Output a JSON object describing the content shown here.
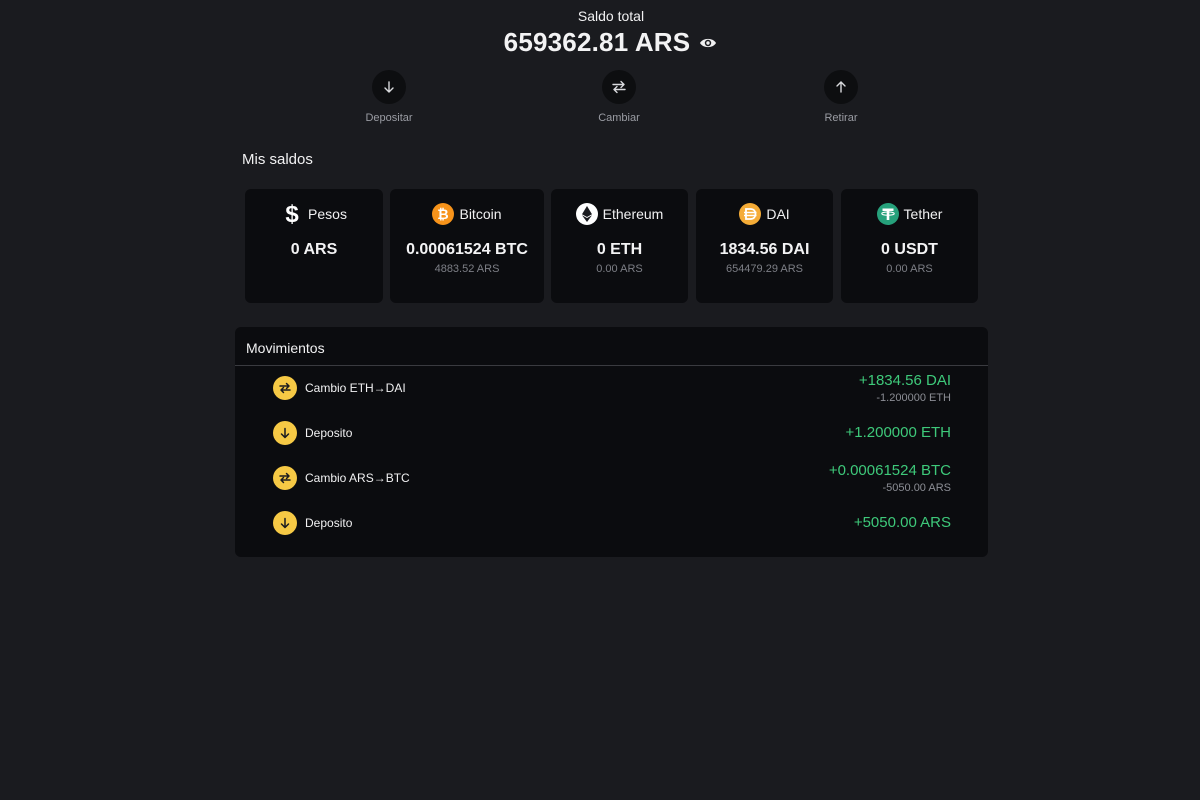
{
  "header": {
    "total_label": "Saldo total",
    "total_value": "659362.81 ARS",
    "eye_icon": "eye-icon"
  },
  "actions": [
    {
      "label": "Depositar",
      "icon": "arrow-down-icon"
    },
    {
      "label": "Cambiar",
      "icon": "swap-arrows-icon"
    },
    {
      "label": "Retirar",
      "icon": "arrow-up-icon"
    }
  ],
  "balances": {
    "title": "Mis saldos",
    "cards": [
      {
        "name": "Pesos",
        "amount": "0 ARS",
        "fiat": "",
        "icon": "dollar-icon",
        "color": "#ffffff"
      },
      {
        "name": "Bitcoin",
        "amount": "0.00061524 BTC",
        "fiat": "4883.52 ARS",
        "icon": "bitcoin-icon",
        "color": "#f7931a"
      },
      {
        "name": "Ethereum",
        "amount": "0 ETH",
        "fiat": "0.00 ARS",
        "icon": "ethereum-icon",
        "color": "#ffffff"
      },
      {
        "name": "DAI",
        "amount": "1834.56 DAI",
        "fiat": "654479.29 ARS",
        "icon": "dai-icon",
        "color": "#f5ac37"
      },
      {
        "name": "Tether",
        "amount": "0 USDT",
        "fiat": "0.00 ARS",
        "icon": "tether-icon",
        "color": "#26a17b"
      }
    ]
  },
  "movements": {
    "title": "Movimientos",
    "items": [
      {
        "description": "Cambio ETH→DAI",
        "amount": "+1834.56 DAI",
        "sub": "-1.200000 ETH",
        "icon": "swap-arrows-icon"
      },
      {
        "description": "Deposito",
        "amount": "+1.200000 ETH",
        "sub": "",
        "icon": "arrow-down-icon"
      },
      {
        "description": "Cambio ARS→BTC",
        "amount": "+0.00061524 BTC",
        "sub": "-5050.00 ARS",
        "icon": "swap-arrows-icon"
      },
      {
        "description": "Deposito",
        "amount": "+5050.00 ARS",
        "sub": "",
        "icon": "arrow-down-icon"
      }
    ]
  },
  "colors": {
    "background": "#1a1b1f",
    "card": "#0b0c0f",
    "positive": "#3ec97a",
    "accent": "#f6c945"
  }
}
